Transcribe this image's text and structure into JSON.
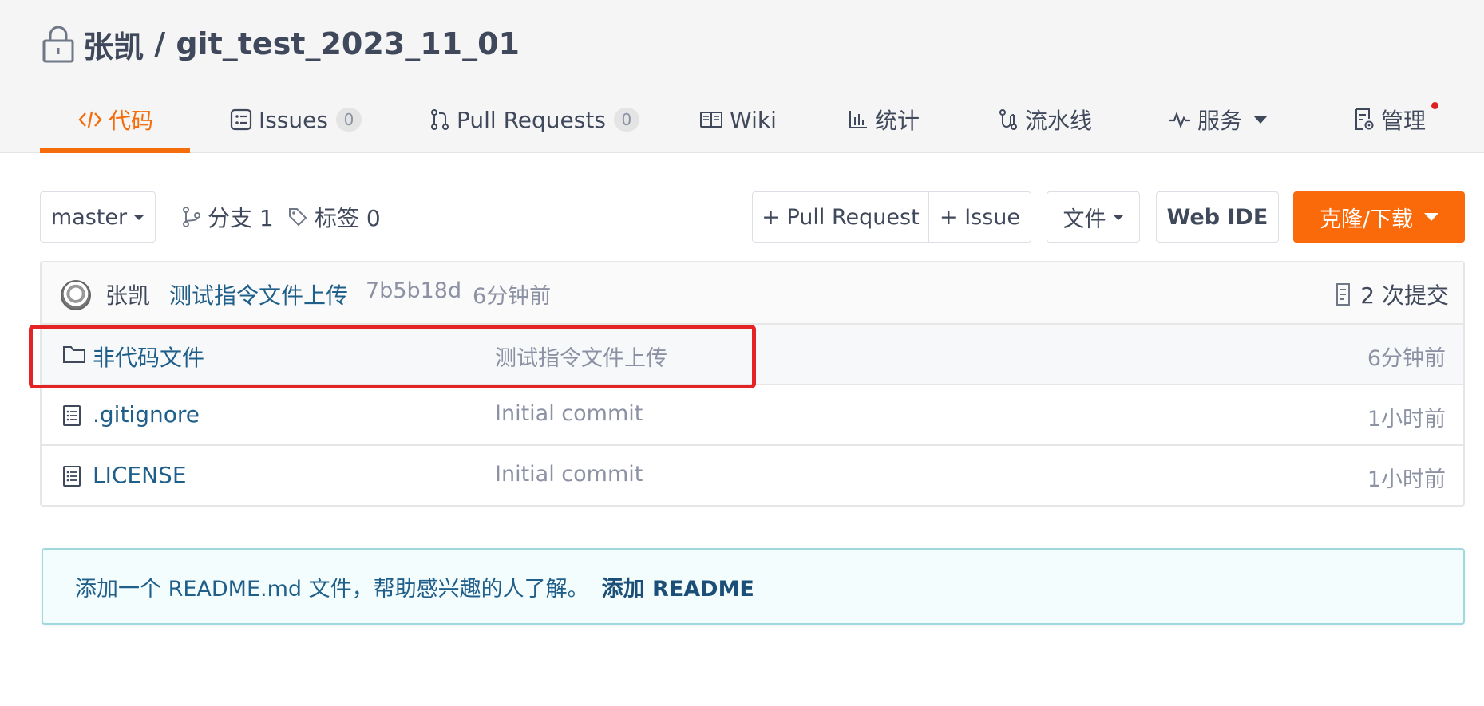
{
  "repo": {
    "owner": "张凯",
    "separator": " / ",
    "name": "git_test_2023_11_01"
  },
  "tabs": [
    {
      "label": "代码",
      "icon": "code-icon",
      "active": true
    },
    {
      "label": "Issues",
      "icon": "issues-icon",
      "count": "0"
    },
    {
      "label": "Pull Requests",
      "icon": "pull-request-icon",
      "count": "0"
    },
    {
      "label": "Wiki",
      "icon": "book-icon"
    },
    {
      "label": "统计",
      "icon": "bar-chart-icon"
    },
    {
      "label": "流水线",
      "icon": "pipeline-icon"
    },
    {
      "label": "服务",
      "icon": "pulse-icon"
    },
    {
      "label": "管理",
      "icon": "settings-doc-icon"
    }
  ],
  "toolbar": {
    "branch": "master",
    "branches_label": "分支 1",
    "tags_label": "标签 0",
    "pull_request_button": "+ Pull Request",
    "issue_button": "+ Issue",
    "file_button": "文件",
    "web_ide_button": "Web IDE",
    "clone_button": "克隆/下载"
  },
  "latest_commit": {
    "author": "张凯",
    "message": "测试指令文件上传",
    "hash": "7b5b18d",
    "time": "6分钟前",
    "commit_count": "2 次提交"
  },
  "files": [
    {
      "name": "非代码文件",
      "type": "folder",
      "commit": "测试指令文件上传",
      "time": "6分钟前"
    },
    {
      "name": ".gitignore",
      "type": "file",
      "commit": "Initial commit",
      "time": "1小时前"
    },
    {
      "name": "LICENSE",
      "type": "file",
      "commit": "Initial commit",
      "time": "1小时前"
    }
  ],
  "readme_notice": {
    "text": "添加一个 README.md 文件，帮助感兴趣的人了解。",
    "link": "添加 README"
  },
  "colors": {
    "accent": "#f56c0a",
    "clone_button": "#fa6a0a",
    "link": "#1f5f8a",
    "highlight_box": "#e42424",
    "notice_border": "#9fd8dd"
  }
}
